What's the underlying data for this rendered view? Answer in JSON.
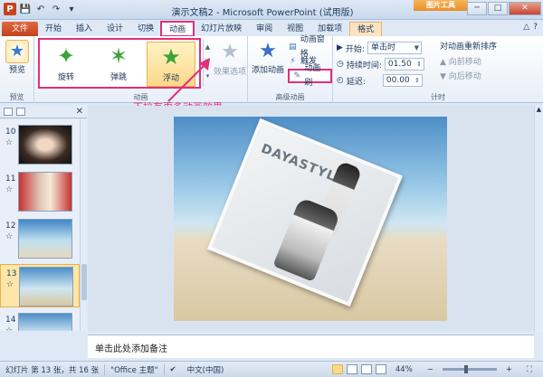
{
  "app": {
    "window_title": "演示文稿2 - Microsoft PowerPoint (试用版)",
    "context_tab_header": "图片工具"
  },
  "tabs": [
    {
      "label": "文件"
    },
    {
      "label": "开始"
    },
    {
      "label": "插入"
    },
    {
      "label": "设计"
    },
    {
      "label": "切换"
    },
    {
      "label": "动画"
    },
    {
      "label": "幻灯片放映"
    },
    {
      "label": "审阅"
    },
    {
      "label": "视图"
    },
    {
      "label": "加载项"
    },
    {
      "label": "格式"
    }
  ],
  "ribbon": {
    "preview": {
      "label": "预览",
      "group": "预览"
    },
    "animation_group": {
      "label": "动画",
      "items": [
        {
          "label": "旋转"
        },
        {
          "label": "弹跳"
        },
        {
          "label": "浮动"
        }
      ],
      "effect_options": "效果选项"
    },
    "advanced_group": {
      "label": "高级动画",
      "add_animation": "添加动画",
      "animation_pane": "动画窗格",
      "trigger": "触发",
      "animation_painter": "动画刷"
    },
    "timing_group": {
      "label": "计时",
      "start_label": "开始:",
      "start_value": "单击时",
      "duration_label": "持续时间:",
      "duration_value": "01.50",
      "delay_label": "延迟:",
      "delay_value": "00.00",
      "reorder_title": "对动画重新排序",
      "move_earlier": "向前移动",
      "move_later": "向后移动"
    }
  },
  "callout": "下拉有更多动画效果",
  "slides": [
    {
      "number": "10",
      "mark": "☆"
    },
    {
      "number": "11",
      "mark": "☆"
    },
    {
      "number": "12",
      "mark": "☆"
    },
    {
      "number": "13",
      "mark": "☆"
    },
    {
      "number": "14",
      "mark": "☆"
    }
  ],
  "slide_content": {
    "brand_text": "DAYASTYLE"
  },
  "notes_placeholder": "单击此处添加备注",
  "status_bar": {
    "slide_info": "幻灯片 第 13 张，共 16 张",
    "theme": "\"Office 主题\"",
    "language": "中文(中国)",
    "zoom": "44%"
  },
  "colors": {
    "accent": "#e0307a",
    "file_tab": "#c0421c",
    "ribbon_bg": "#e8eff8"
  }
}
